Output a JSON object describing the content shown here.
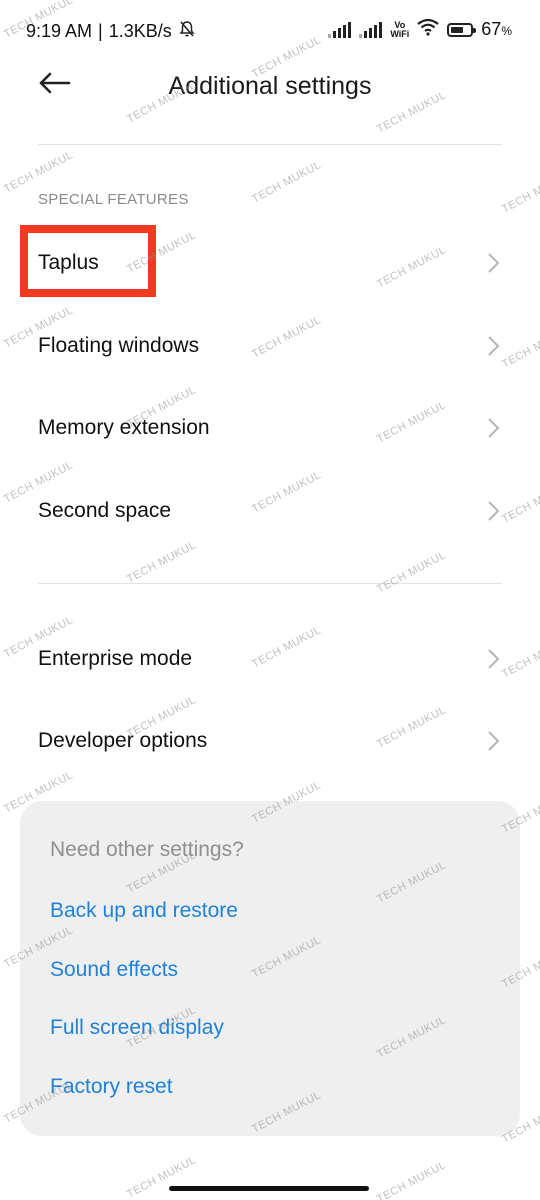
{
  "status_bar": {
    "time": "9:19 AM",
    "separator": "|",
    "speed": "1.3KB/s",
    "vowifi_top": "Vo",
    "vowifi_bottom": "WiFi",
    "battery": "67",
    "battery_percent_sign": "%",
    "battery_level": 0.67
  },
  "header": {
    "title": "Additional settings"
  },
  "special_features": {
    "section_label": "SPECIAL FEATURES",
    "items": [
      {
        "label": "Taplus"
      },
      {
        "label": "Floating windows"
      },
      {
        "label": "Memory extension"
      },
      {
        "label": "Second space"
      }
    ]
  },
  "more": {
    "items": [
      {
        "label": "Enterprise mode"
      },
      {
        "label": "Developer options"
      }
    ]
  },
  "suggestions": {
    "title": "Need other settings?",
    "links": [
      {
        "label": "Back up and restore"
      },
      {
        "label": "Sound effects"
      },
      {
        "label": "Full screen display"
      },
      {
        "label": "Factory reset"
      }
    ]
  },
  "watermark": "TECH MUKUL",
  "colors": {
    "highlight": "#ef3a1f",
    "link": "#1f82d6"
  }
}
